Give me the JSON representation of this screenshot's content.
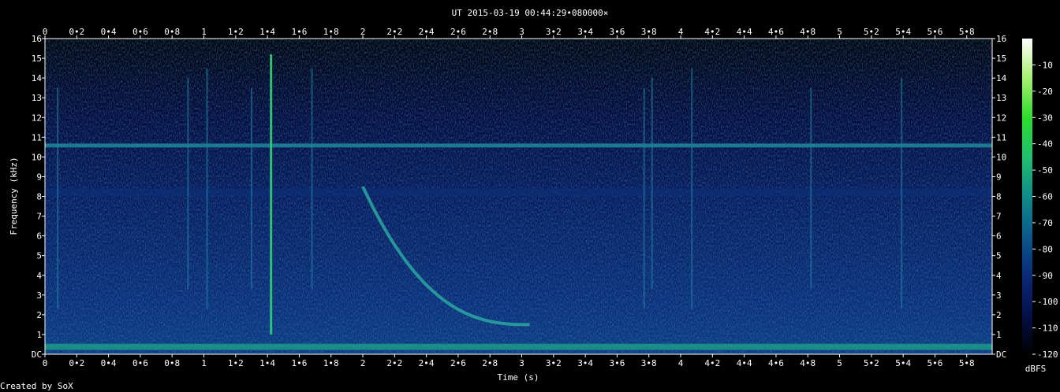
{
  "credit": "Created by SoX",
  "chart_data": {
    "type": "heatmap",
    "title": "UT 2015-03-19 00:44:29•080000×",
    "xlabel": "Time (s)",
    "ylabel": "Frequency (kHz)",
    "xlim": [
      0,
      5.96
    ],
    "ylim": [
      0,
      16
    ],
    "x_ticks": [
      "0",
      "0•2",
      "0•4",
      "0•6",
      "0•8",
      "1",
      "1•2",
      "1•4",
      "1•6",
      "1•8",
      "2",
      "2•2",
      "2•4",
      "2•6",
      "2•8",
      "3",
      "3•2",
      "3•4",
      "3•6",
      "3•8",
      "4",
      "4•2",
      "4•4",
      "4•6",
      "4•8",
      "5",
      "5•2",
      "5•4",
      "5•6",
      "5•8"
    ],
    "y_ticks": [
      "DC",
      "1",
      "2",
      "3",
      "4",
      "5",
      "6",
      "7",
      "8",
      "9",
      "10",
      "11",
      "12",
      "13",
      "14",
      "15",
      "16"
    ],
    "colorbar": {
      "label": "dBFS",
      "ticks": [
        "-10",
        "-20",
        "-30",
        "-40",
        "-50",
        "-60",
        "-70",
        "-80",
        "-90",
        "-100",
        "-110",
        "-120"
      ],
      "range": [
        -120,
        0
      ],
      "colors": [
        "#000000",
        "#06104a",
        "#0a2a7a",
        "#0b5a8e",
        "#0f8c8a",
        "#20c070",
        "#2bdc2b",
        "#a8f070",
        "#ffffff"
      ]
    },
    "features": {
      "background_db": -100,
      "constant_tones_khz": [
        10.6,
        0.45,
        0.3
      ],
      "whistler": {
        "start_time_s": 2.0,
        "start_freq_khz": 8.5,
        "end_time_s": 3.05,
        "end_freq_khz": 1.5
      },
      "sferics_time_s": [
        0.08,
        0.9,
        1.02,
        1.3,
        1.42,
        1.68,
        3.77,
        3.82,
        4.07,
        4.82,
        5.39
      ]
    }
  }
}
